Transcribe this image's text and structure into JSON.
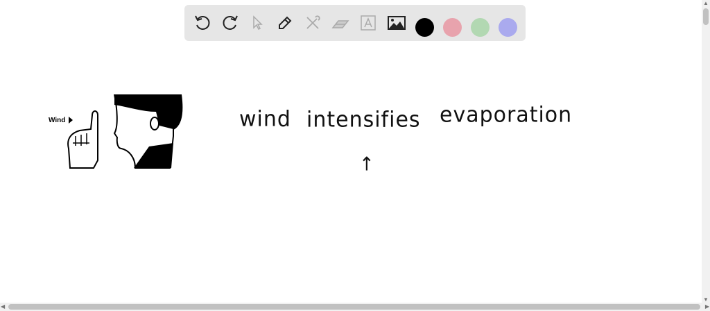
{
  "toolbar": {
    "tools": [
      "undo-icon",
      "redo-icon",
      "select-icon",
      "pen-icon",
      "tools-icon",
      "eraser-icon",
      "text-icon",
      "image-icon"
    ],
    "colors": [
      "#000000",
      "#e8a3ad",
      "#b2d8b2",
      "#aaaaee"
    ]
  },
  "canvas": {
    "illustration_label": "Wind",
    "handwriting": {
      "line1a": "wind",
      "line1b": "intensifies",
      "line1c": "evaporation",
      "mark": "↑"
    }
  }
}
